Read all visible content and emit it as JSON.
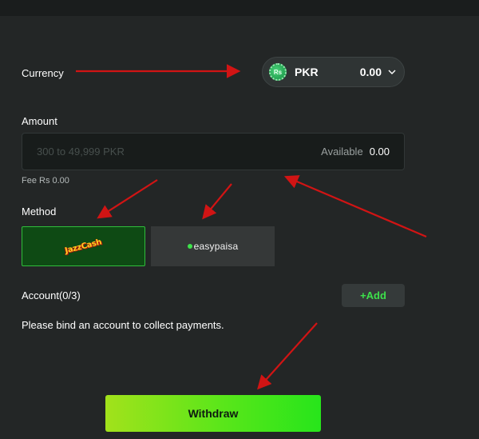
{
  "currency": {
    "label": "Currency",
    "code": "PKR",
    "balance": "0.00",
    "coin_symbol": "Rs",
    "icon": "rupee-coin-icon"
  },
  "amount": {
    "label": "Amount",
    "placeholder": "300 to 49,999 PKR",
    "value": "",
    "available_label": "Available",
    "available_value": "0.00"
  },
  "fee": {
    "text": "Fee Rs 0.00"
  },
  "method": {
    "label": "Method",
    "options": [
      {
        "name": "JazzCash",
        "logo_text": "JazzCash",
        "selected": true
      },
      {
        "name": "easypaisa",
        "logo_text": "easypaisa",
        "selected": false
      }
    ]
  },
  "account": {
    "label": "Account(0/3)",
    "add_label": "+Add",
    "message": "Please bind an account to collect payments."
  },
  "withdraw": {
    "label": "Withdraw"
  },
  "colors": {
    "accent_green": "#3de04b",
    "annotation_red": "#d11414",
    "background": "#232626"
  }
}
